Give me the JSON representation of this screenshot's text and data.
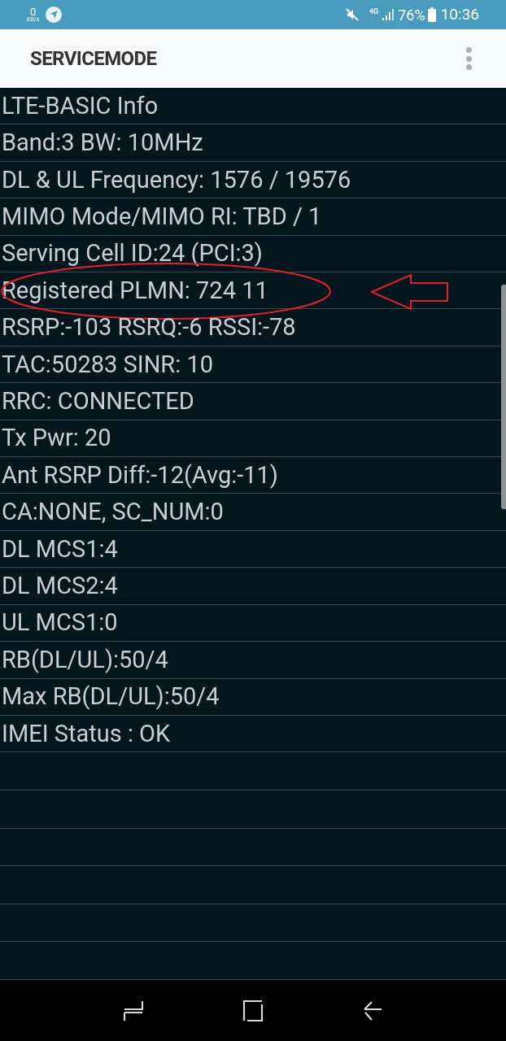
{
  "status_bar": {
    "speed_value": "0",
    "speed_unit": "KB/s",
    "network": "4G",
    "battery": "76%",
    "time": "10:36"
  },
  "app_bar": {
    "title": "SERVICEMODE"
  },
  "rows": [
    {
      "text": "LTE-BASIC Info",
      "highlighted": false
    },
    {
      "text": "Band:3 BW: 10MHz",
      "highlighted": false
    },
    {
      "text": "DL & UL Frequency: 1576 / 19576",
      "highlighted": false
    },
    {
      "text": "MIMO Mode/MIMO RI: TBD / 1",
      "highlighted": false
    },
    {
      "text": "Serving Cell ID:24 (PCI:3)",
      "highlighted": false
    },
    {
      "text": "Registered PLMN: 724 11",
      "highlighted": true
    },
    {
      "text": "RSRP:-103 RSRQ:-6 RSSI:-78",
      "highlighted": false
    },
    {
      "text": "TAC:50283 SINR: 10",
      "highlighted": false
    },
    {
      "text": "RRC: CONNECTED",
      "highlighted": false
    },
    {
      "text": "Tx Pwr: 20",
      "highlighted": false
    },
    {
      "text": "Ant RSRP Diff:-12(Avg:-11)",
      "highlighted": false
    },
    {
      "text": "CA:NONE, SC_NUM:0",
      "highlighted": false
    },
    {
      "text": "DL MCS1:4",
      "highlighted": false
    },
    {
      "text": "DL MCS2:4",
      "highlighted": false
    },
    {
      "text": "UL MCS1:0",
      "highlighted": false
    },
    {
      "text": "RB(DL/UL):50/4",
      "highlighted": false
    },
    {
      "text": "Max RB(DL/UL):50/4",
      "highlighted": false
    },
    {
      "text": "IMEI Status : OK",
      "highlighted": false
    }
  ]
}
